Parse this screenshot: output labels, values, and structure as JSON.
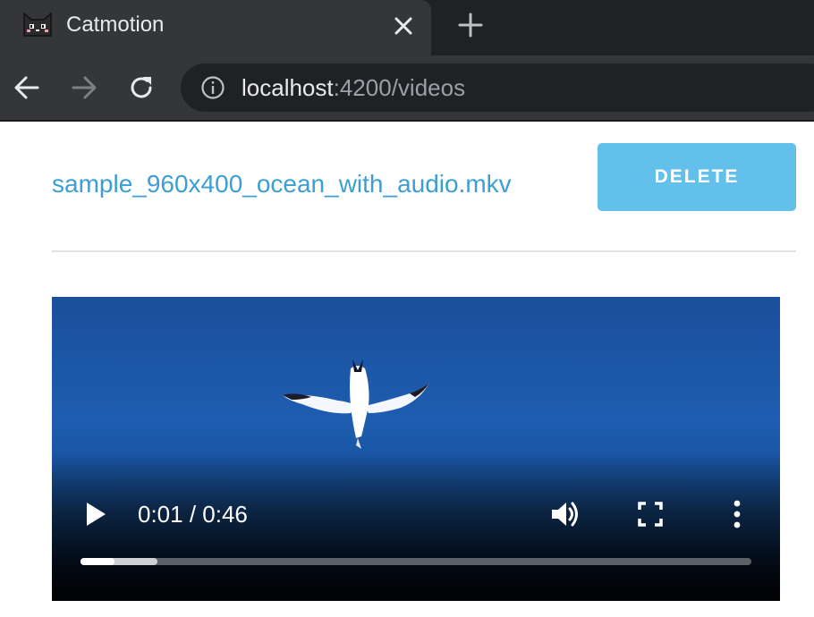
{
  "browser": {
    "tab": {
      "title": "Catmotion",
      "favicon": "cat-icon",
      "close_icon": "close-icon"
    },
    "new_tab_icon": "plus-icon",
    "nav": {
      "back_icon": "arrow-left-icon",
      "forward_icon": "arrow-right-icon",
      "reload_icon": "reload-icon"
    },
    "omnibox": {
      "info_icon": "info-icon",
      "host": "localhost",
      "path": ":4200/videos"
    }
  },
  "page": {
    "filename": "sample_960x400_ocean_with_audio.mkv",
    "delete_label": "DELETE",
    "video": {
      "current_time": "0:01",
      "separator": " / ",
      "duration": "0:46",
      "played_fraction": 0.05,
      "buffered_fraction": 0.115,
      "play_icon": "play-icon",
      "volume_icon": "volume-icon",
      "fullscreen_icon": "fullscreen-icon",
      "more_icon": "more-vertical-icon"
    }
  },
  "colors": {
    "link": "#3c9ed3",
    "delete_button": "#62c0ea",
    "browser_frame": "#35363a",
    "tabstrip": "#202124"
  }
}
